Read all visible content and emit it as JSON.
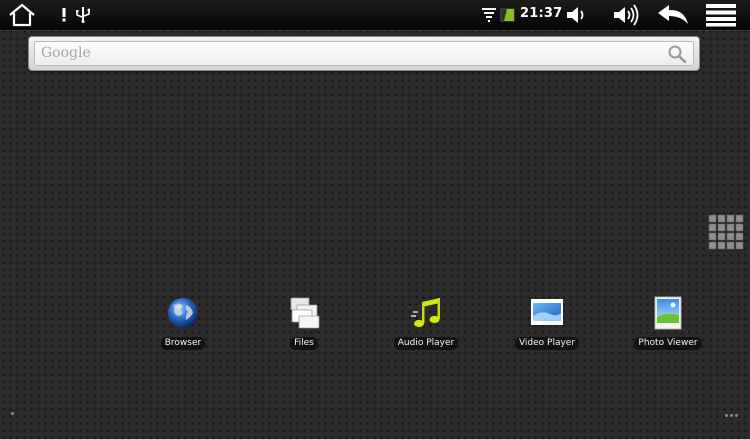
{
  "status_bar": {
    "time": "21:37"
  },
  "search": {
    "placeholder": "Google"
  },
  "apps": [
    {
      "label": "Browser",
      "icon": "globe-icon"
    },
    {
      "label": "Files",
      "icon": "folder-stack-icon"
    },
    {
      "label": "Audio Player",
      "icon": "music-note-icon"
    },
    {
      "label": "Video Player",
      "icon": "video-screen-icon"
    },
    {
      "label": "Photo Viewer",
      "icon": "photo-icon"
    }
  ],
  "colors": {
    "background": "#2a2b2a",
    "status_bar": "#0b0b0b",
    "battery": "#7fc31c",
    "label_text": "#f2f2f2"
  }
}
